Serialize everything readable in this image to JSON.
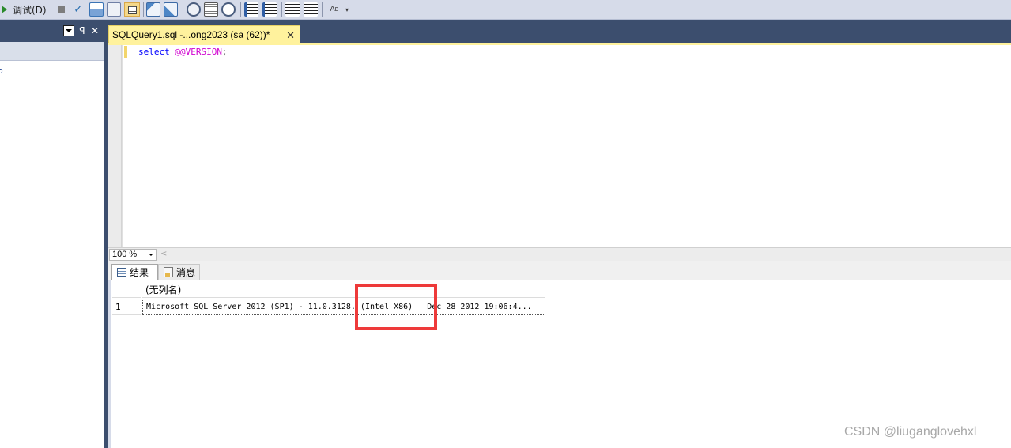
{
  "toolbar": {
    "debug_label": "调试(D)",
    "icons": [
      "stop-icon",
      "parse-check-icon",
      "design-query-icon",
      "query-options-icon",
      "results-to-grid-icon",
      "include-plan-icon",
      "include-stats-icon",
      "client-stats-icon",
      "results-text-icon",
      "results-file-icon",
      "comment-icon",
      "uncomment-icon",
      "decrease-indent-icon",
      "increase-indent-icon",
      "specify-values-icon"
    ]
  },
  "left_panel": {
    "dropdown_icon": "dropdown-icon",
    "pin_glyph": "ꟼ",
    "close_glyph": "✕",
    "tree_fragment": "o"
  },
  "editor": {
    "tab_title": "SQLQuery1.sql -...ong2023 (sa (62))*",
    "tab_close": "✕",
    "code_keyword": "select",
    "code_variable": "@@VERSION",
    "code_punct": ";"
  },
  "zoom": {
    "value": "100 %",
    "scroll_left_glyph": "<"
  },
  "results_tabs": [
    {
      "label": "结果",
      "icon": "grid-icon",
      "active": true
    },
    {
      "label": "消息",
      "icon": "messages-icon",
      "active": false
    }
  ],
  "results_grid": {
    "column_header": "(无列名)",
    "rows": [
      {
        "num": "1",
        "value": "Microsoft SQL Server 2012 (SP1) - 11.0.3128. (Intel X86)   Dec 28 2012 19:06:4..."
      }
    ]
  },
  "colors": {
    "toolbar_bg": "#d6dbe9",
    "panel_dark": "#3c4e6e",
    "tab_yellow": "#fff29d",
    "highlight_red": "#ee3a3a"
  },
  "watermark": "CSDN @liuganglovehxl"
}
